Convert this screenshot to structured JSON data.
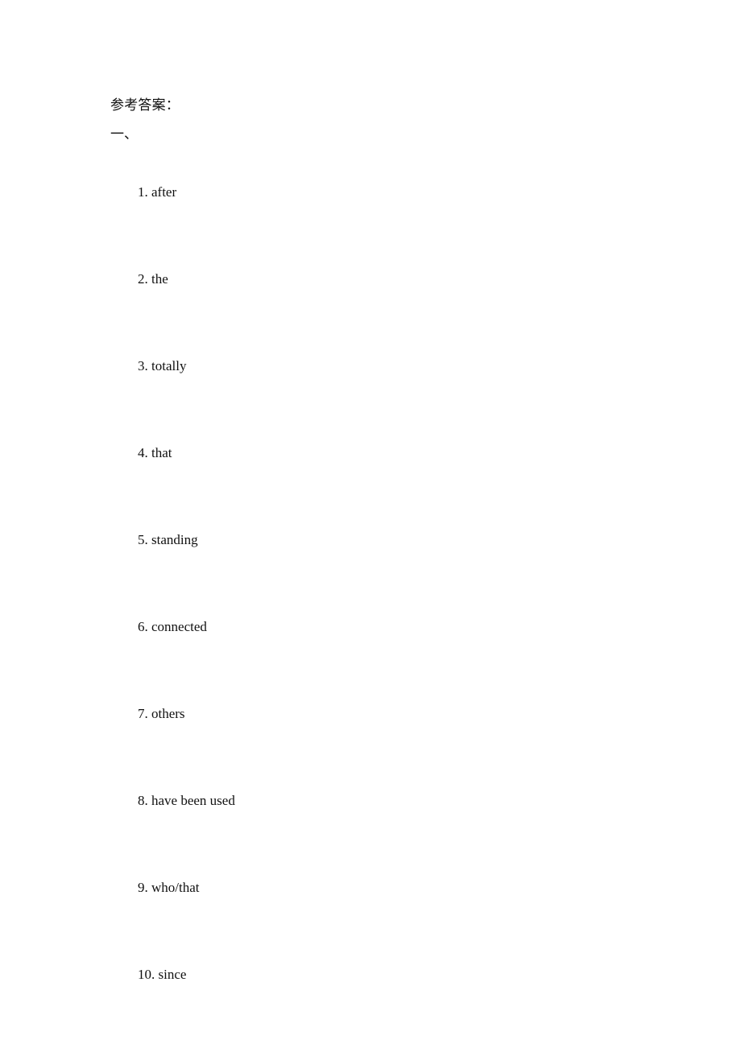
{
  "document": {
    "background_color": "#ffffff",
    "text_color": "#111111",
    "heading": "参考答案：",
    "section_label": "一、",
    "answers": [
      {
        "number": "1.",
        "text": "after"
      },
      {
        "number": "2.",
        "text": "the"
      },
      {
        "number": "3.",
        "text": "totally"
      },
      {
        "number": "4.",
        "text": "that"
      },
      {
        "number": "5.",
        "text": "standing"
      },
      {
        "number": "6.",
        "text": "connected"
      },
      {
        "number": "7.",
        "text": "others"
      },
      {
        "number": "8.",
        "text": "have been used"
      },
      {
        "number": "9.",
        "text": "who/that"
      },
      {
        "number": "10.",
        "text": "since"
      }
    ]
  }
}
